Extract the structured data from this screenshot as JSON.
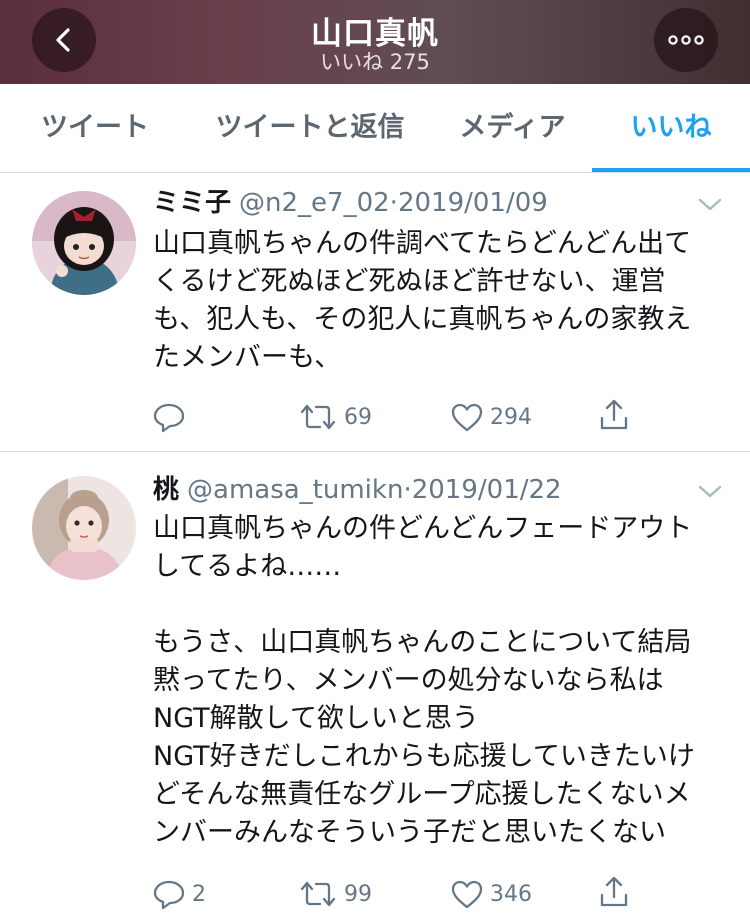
{
  "header": {
    "title": "山口真帆",
    "subtitle": "いいね 275"
  },
  "tabs": [
    {
      "label": "ツイート"
    },
    {
      "label": "ツイートと返信"
    },
    {
      "label": "メディア"
    },
    {
      "label": "いいね"
    }
  ],
  "active_tab": "いいね",
  "colors": {
    "accent": "#1da1f2",
    "text": "#14171a",
    "secondary": "#657786",
    "divider": "#d8dde1"
  },
  "tweets": [
    {
      "name": "ミミ子",
      "handle": "@n2_e7_02",
      "separator": "·",
      "date": "2019/01/09",
      "lines": [
        "山口真帆ちゃんの件調べてたらどんどん出て",
        "くるけど死ぬほど死ぬほど許せない、運営",
        "も、犯人も、その犯人に真帆ちゃんの家教え",
        "たメンバーも、"
      ],
      "replies": "",
      "retweets": "69",
      "likes": "294"
    },
    {
      "name": "桃",
      "handle": "@amasa_tumikn",
      "separator": "·",
      "date": "2019/01/22",
      "lines": [
        "山口真帆ちゃんの件どんどんフェードアウト",
        "してるよね……",
        "",
        "もうさ、山口真帆ちゃんのことについて結局",
        "黙ってたり、メンバーの処分ないなら私は",
        "NGT解散して欲しいと思う",
        "NGT好きだしこれからも応援していきたいけ",
        "どそんな無責任なグループ応援したくないメ",
        "ンバーみんなそういう子だと思いたくない"
      ],
      "replies": "2",
      "retweets": "99",
      "likes": "346"
    }
  ],
  "icons": {
    "back": "chevron-left-icon",
    "more": "more-horizontal-icon",
    "reply": "reply-icon",
    "retweet": "retweet-icon",
    "like": "heart-icon",
    "share": "share-icon",
    "caret": "chevron-down-icon"
  }
}
